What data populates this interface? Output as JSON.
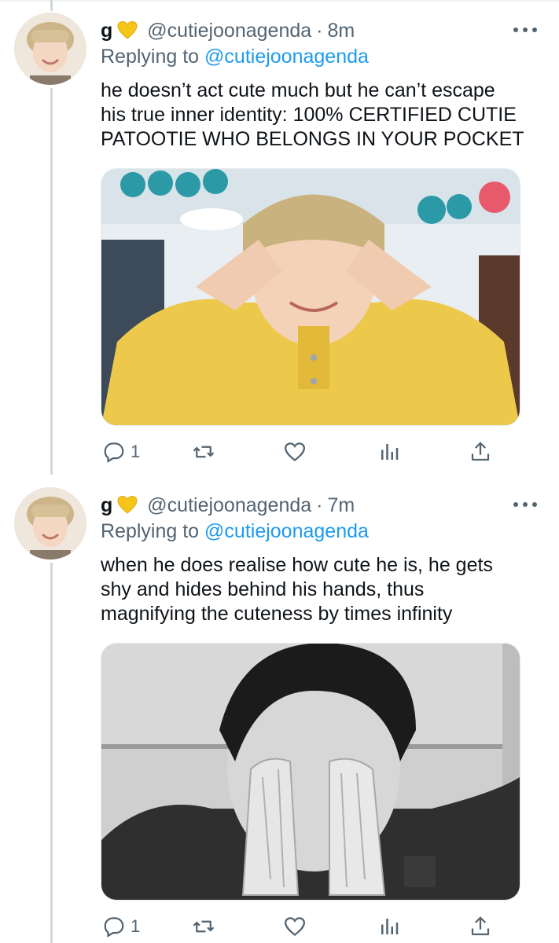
{
  "tweets": [
    {
      "name": "g",
      "handle": "@cutiejoonagenda",
      "separator": "·",
      "time": "8m",
      "replying_label": "Replying to",
      "replying_handle": "@cutiejoonagenda",
      "text": "he doesn’t act cute much but he can’t escape\nhis true inner identity: 100% CERTIFIED CUTIE\nPATOOTIE WHO BELONGS IN YOUR POCKET",
      "media_description": "person in yellow sweater making peace signs over eyes",
      "reply_count": "1",
      "retweet_count": "",
      "like_count": "",
      "analytics_count": ""
    },
    {
      "name": "g",
      "handle": "@cutiejoonagenda",
      "separator": "·",
      "time": "7m",
      "replying_label": "Replying to",
      "replying_handle": "@cutiejoonagenda",
      "text": "when he does realise how cute he is, he gets\nshy and hides behind his hands, thus\nmagnifying the cuteness by times infinity",
      "media_description": "black and white photo of person covering face with hands",
      "reply_count": "1",
      "retweet_count": "",
      "like_count": "",
      "analytics_count": ""
    }
  ],
  "colors": {
    "accent": "#1d9bf0",
    "muted": "#536471",
    "text": "#0f1419",
    "thread_line": "#cfd9de",
    "heart_emoji": "#f5c518"
  },
  "icons": [
    "reply-icon",
    "retweet-icon",
    "like-icon",
    "analytics-icon",
    "share-icon",
    "more-icon",
    "yellow-heart-icon"
  ]
}
